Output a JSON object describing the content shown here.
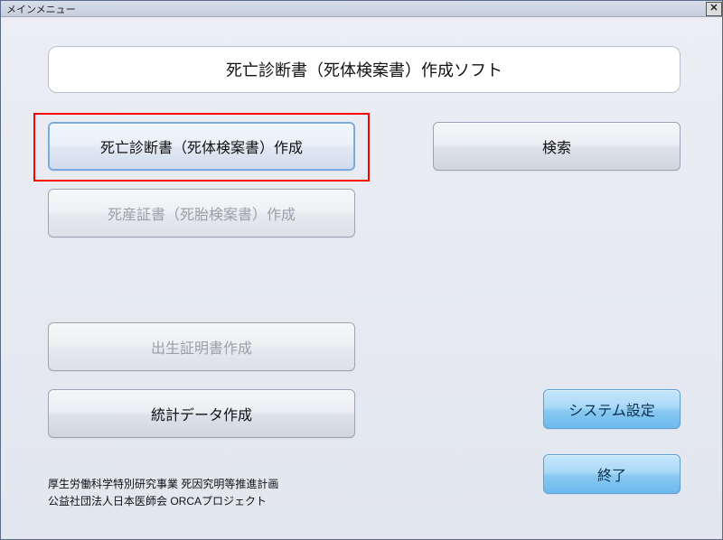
{
  "window": {
    "title": "メインメニュー"
  },
  "header": {
    "title": "死亡診断書（死体検案書）作成ソフト"
  },
  "buttons": {
    "create_death_cert": "死亡診断書（死体検案書）作成",
    "search": "検索",
    "create_stillbirth_cert": "死産証書（死胎検案書）作成",
    "create_birth_cert": "出生証明書作成",
    "create_statistics": "統計データ作成",
    "system_settings": "システム設定",
    "exit": "終了"
  },
  "footer": {
    "line1": "厚生労働科学特別研究事業 死因究明等推進計画",
    "line2": "公益社団法人日本医師会 ORCAプロジェクト"
  },
  "colors": {
    "highlight": "#ff0000",
    "blue_button_bg": "#89c9f2"
  }
}
